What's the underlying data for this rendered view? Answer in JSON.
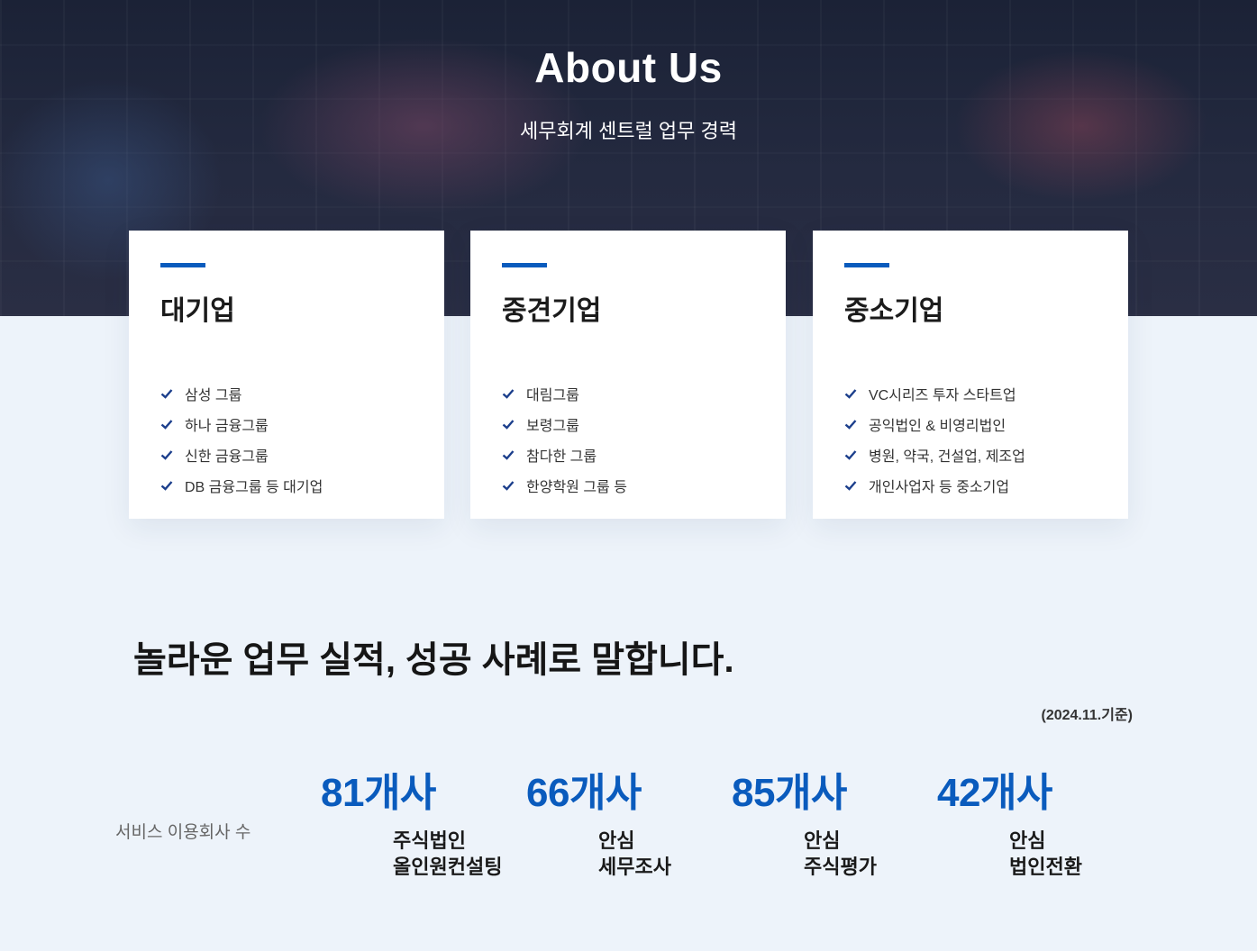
{
  "hero": {
    "title": "About Us",
    "subtitle": "세무회계 센트럴 업무 경력"
  },
  "cards": [
    {
      "title": "대기업",
      "items": [
        "삼성 그룹",
        "하나 금융그룹",
        "신한 금융그룹",
        "DB 금융그룹 등 대기업"
      ]
    },
    {
      "title": "중견기업",
      "items": [
        "대림그룹",
        "보령그룹",
        "참다한 그룹",
        "한양학원 그룹 등"
      ]
    },
    {
      "title": "중소기업",
      "items": [
        "VC시리즈 투자 스타트업",
        "공익법인 & 비영리법인",
        "병원, 약국, 건설업, 제조업",
        "개인사업자 등 중소기업"
      ]
    }
  ],
  "results": {
    "title": "놀라운 업무 실적, 성공 사례로 말합니다.",
    "basis": "(2024.11.기준)",
    "label": "서비스 이용회사 수",
    "stats": [
      {
        "number": "81개사",
        "desc": "주식법인\n올인원컨설팅"
      },
      {
        "number": "66개사",
        "desc": "안심\n세무조사"
      },
      {
        "number": "85개사",
        "desc": "안심\n주식평가"
      },
      {
        "number": "42개사",
        "desc": "안심\n법인전환"
      }
    ]
  },
  "colors": {
    "accent": "#0a5bbd",
    "background": "#edf3fa",
    "hero": "#1f2538"
  },
  "icons": {
    "list_bullet": "check-icon"
  }
}
